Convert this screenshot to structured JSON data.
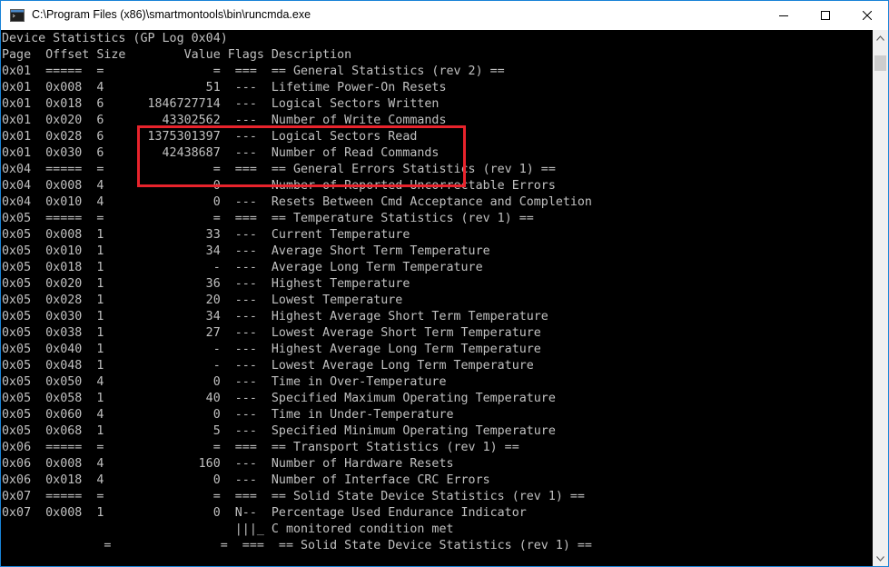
{
  "window": {
    "title": "C:\\Program Files (x86)\\smartmontools\\bin\\runcmda.exe",
    "minimize_glyph": "—",
    "maximize_glyph": "☐",
    "close_glyph": "✕"
  },
  "console": {
    "lines": [
      "Device Statistics (GP Log 0x04)",
      "Page  Offset Size        Value Flags Description",
      "0x01  =====  =               =  ===  == General Statistics (rev 2) ==",
      "0x01  0x008  4              51  ---  Lifetime Power-On Resets",
      "0x01  0x018  6      1846727714  ---  Logical Sectors Written",
      "0x01  0x020  6        43302562  ---  Number of Write Commands",
      "0x01  0x028  6      1375301397  ---  Logical Sectors Read",
      "0x01  0x030  6        42438687  ---  Number of Read Commands",
      "0x04  =====  =               =  ===  == General Errors Statistics (rev 1) ==",
      "0x04  0x008  4               0  ---  Number of Reported Uncorrectable Errors",
      "0x04  0x010  4               0  ---  Resets Between Cmd Acceptance and Completion",
      "0x05  =====  =               =  ===  == Temperature Statistics (rev 1) ==",
      "0x05  0x008  1              33  ---  Current Temperature",
      "0x05  0x010  1              34  ---  Average Short Term Temperature",
      "0x05  0x018  1               -  ---  Average Long Term Temperature",
      "0x05  0x020  1              36  ---  Highest Temperature",
      "0x05  0x028  1              20  ---  Lowest Temperature",
      "0x05  0x030  1              34  ---  Highest Average Short Term Temperature",
      "0x05  0x038  1              27  ---  Lowest Average Short Term Temperature",
      "0x05  0x040  1               -  ---  Highest Average Long Term Temperature",
      "0x05  0x048  1               -  ---  Lowest Average Long Term Temperature",
      "0x05  0x050  4               0  ---  Time in Over-Temperature",
      "0x05  0x058  1              40  ---  Specified Maximum Operating Temperature",
      "0x05  0x060  4               0  ---  Time in Under-Temperature",
      "0x05  0x068  1               5  ---  Specified Minimum Operating Temperature",
      "0x06  =====  =               =  ===  == Transport Statistics (rev 1) ==",
      "0x06  0x008  4             160  ---  Number of Hardware Resets",
      "0x06  0x018  4               0  ---  Number of Interface CRC Errors",
      "0x07  =====  =               =  ===  == Solid State Device Statistics (rev 1) ==",
      "0x07  0x008  1               0  N--  Percentage Used Endurance Indicator",
      "                                |||_ C monitored condition met",
      "              =               =  ===  == Solid State Device Statistics (rev 1) =="
    ]
  },
  "colors": {
    "console_bg": "#000000",
    "console_fg": "#c0c0c0",
    "highlight": "#e8232c",
    "window_border": "#1883d7"
  },
  "icons": {
    "title": "console-app-icon",
    "scroll_up": "scroll-up-arrow-icon",
    "scroll_down": "scroll-down-arrow-icon"
  }
}
